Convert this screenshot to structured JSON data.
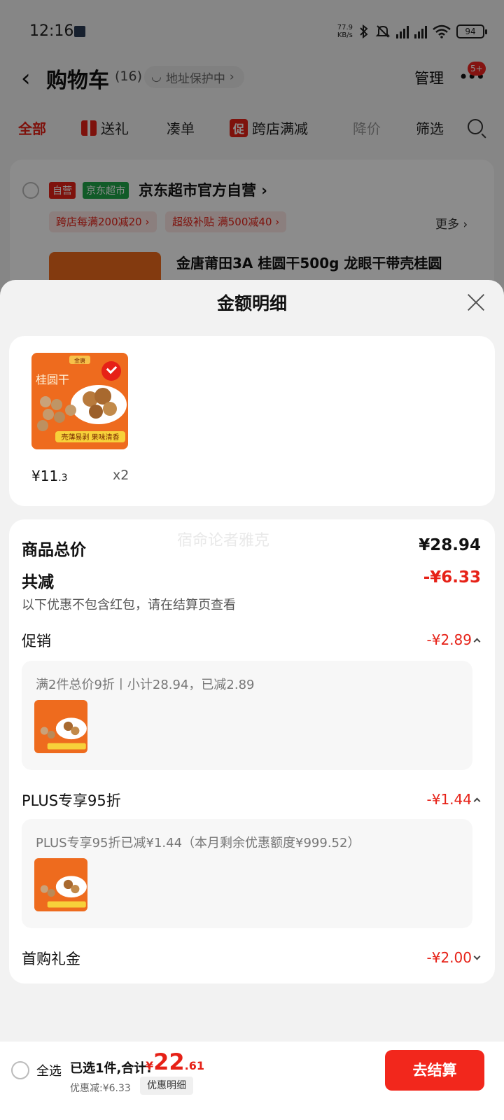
{
  "status": {
    "time": "12:16",
    "net_speed_value": "77.9",
    "net_speed_unit": "KB/s",
    "battery": "94"
  },
  "nav": {
    "back": "‹",
    "title": "购物车",
    "count": "(16)",
    "address": "地址保护中",
    "manage": "管理",
    "more": "•••",
    "badge": "5+"
  },
  "tabs": [
    {
      "label": "全部"
    },
    {
      "label": "送礼"
    },
    {
      "label": "凑单"
    },
    {
      "label": "跨店满减",
      "tag": "促"
    },
    {
      "label": "降价"
    },
    {
      "label": "筛选"
    }
  ],
  "store": {
    "tag_self": "自营",
    "tag_market": "京东超市",
    "name": "京东超市官方自营",
    "coupons": [
      "跨店每满200减20 ›",
      "超级补贴 满500减40 ›"
    ],
    "more": "更多 ›",
    "product_title": "金唐莆田3A 桂圆干500g 龙眼干带壳桂圆"
  },
  "sheet": {
    "title": "金额明细",
    "item": {
      "price_int": "¥11",
      "price_dec": ".3",
      "qty": "x2",
      "img_title": "桂圆干",
      "img_caption": "壳薄易剥 果味清香",
      "img_brand": "金唐"
    },
    "watermark": "宿命论者雅克",
    "total_label": "商品总价",
    "total_value": "¥28.94",
    "reduce_label": "共减",
    "reduce_value": "-¥6.33",
    "note": "以下优惠不包含红包，请在结算页查看",
    "promo_label": "促销",
    "promo_value": "-¥2.89",
    "promo_detail": "满2件总价9折丨小计28.94，已减2.89",
    "plus_label": "PLUS专享95折",
    "plus_value": "-¥1.44",
    "plus_detail": "PLUS专享95折已减¥1.44（本月剩余优惠额度¥999.52）",
    "first_label": "首购礼金",
    "first_value": "-¥2.00"
  },
  "footer": {
    "select_all": "全选",
    "selected": "已选1件,合计:",
    "total_currency": "¥",
    "total_int": "22",
    "total_dec": ".61",
    "discount": "优惠减:¥6.33",
    "detail_button": "优惠明细",
    "checkout": "去结算"
  },
  "colors": {
    "accent": "#e62117",
    "green": "#1fa64a"
  }
}
